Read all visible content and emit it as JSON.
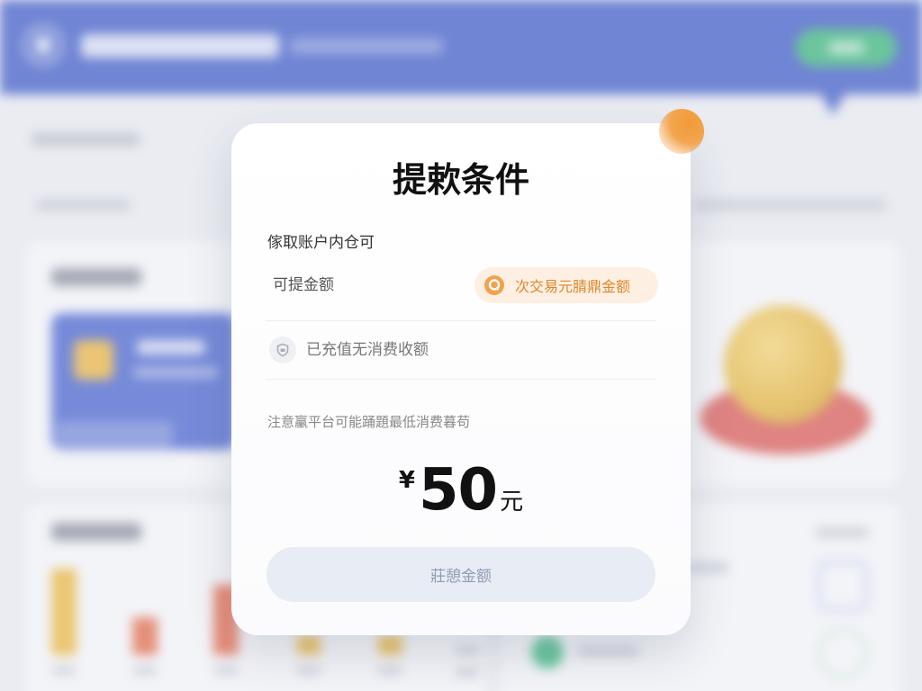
{
  "modal": {
    "title": "提欶条件",
    "subtitle": "傢取账户内仓可",
    "row_withdrawable": {
      "label": "可提金额",
      "tag": "次交易元腈鼎金额",
      "tag_icon": "coin-icon"
    },
    "row_recharged": {
      "label": "已充值无消费收额",
      "icon": "shield-icon"
    },
    "note": "注意臝平台可能踊題最低消费暮苟",
    "amount": {
      "currency": "¥",
      "value": "50",
      "unit": "元"
    },
    "button_label": "莊憩金额"
  },
  "colors": {
    "header_blue": "#3f5cc6",
    "accent_orange": "#e0862a",
    "tag_bg": "#fdf0e2",
    "button_bg": "#e8ecf4",
    "button_text": "#8f9bb3",
    "header_action_green": "#39b57a"
  }
}
